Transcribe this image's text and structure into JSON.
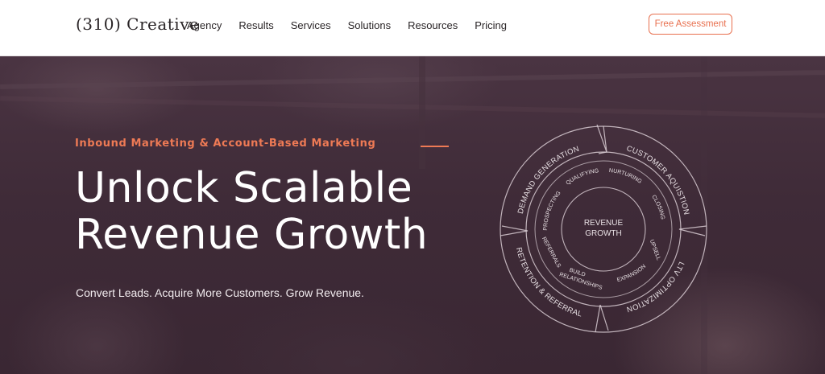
{
  "header": {
    "logo_text": "(310) Creative",
    "nav": [
      {
        "label": "Agency"
      },
      {
        "label": "Results"
      },
      {
        "label": "Services"
      },
      {
        "label": "Solutions"
      },
      {
        "label": "Resources"
      },
      {
        "label": "Pricing"
      }
    ],
    "cta_label": "Free Assessment"
  },
  "hero": {
    "eyebrow": "Inbound Marketing & Account-Based Marketing",
    "headline_line1": "Unlock Scalable",
    "headline_line2": "Revenue Growth",
    "subhead": "Convert Leads. Acquire More Customers. Grow Revenue."
  },
  "wheel": {
    "center_line1": "REVENUE",
    "center_line2": "GROWTH",
    "outer": {
      "demand_generation": "DEMAND GENERATION",
      "customer_acquisition": "CUSTOMER AQUISTION",
      "ltv_optimization": "LTV OPTIMIZATION",
      "retention_referral": "RETENTION & REFERRAL"
    },
    "inner": {
      "qualifying": "QUALIFYING",
      "nurturing": "NURTURING",
      "closing": "CLOSING",
      "upsell": "UPSELL",
      "expansion": "EXPANSION",
      "build_relationships_1": "BUILD",
      "build_relationships_2": "RELATIONSHIPS",
      "referrals": "REFERRALS",
      "prospecting": "PROSPECTING"
    }
  },
  "colors": {
    "accent": "#ee7a55",
    "hero_bg": "#3f2b37",
    "text_dark": "#2a2527"
  }
}
